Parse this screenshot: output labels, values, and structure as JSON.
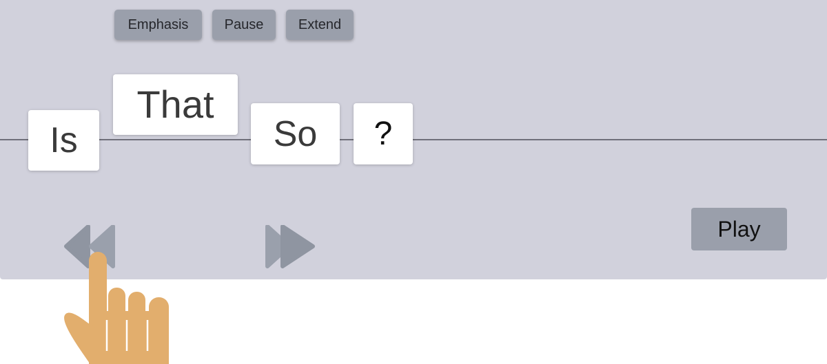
{
  "toolbar": {
    "emphasis_label": "Emphasis",
    "pause_label": "Pause",
    "extend_label": "Extend"
  },
  "sentence": {
    "words": [
      "Is",
      "That",
      "So",
      "?"
    ]
  },
  "controls": {
    "play_label": "Play",
    "rewind_icon": "rewind-icon",
    "fast_forward_icon": "fast-forward-icon"
  },
  "cursor": {
    "icon": "pointing-hand-icon"
  },
  "colors": {
    "panel_background": "#d1d1dc",
    "button_gray": "#9a9fab",
    "baseline": "#6f6f7a",
    "word_card": "#ffffff",
    "hand": "#e2ae6d"
  }
}
